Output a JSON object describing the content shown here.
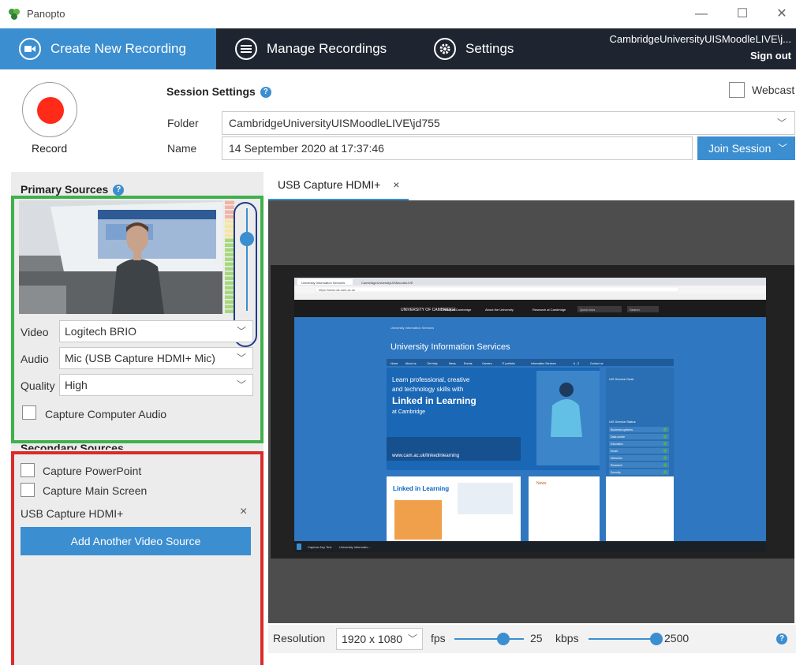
{
  "titlebar": {
    "app_title": "Panopto",
    "minimize": "—",
    "maximize": "☐",
    "close": "✕"
  },
  "nav": {
    "tabs": [
      {
        "label": "Create New Recording",
        "icon": "camera-icon",
        "active": true
      },
      {
        "label": "Manage Recordings",
        "icon": "list-icon",
        "active": false
      },
      {
        "label": "Settings",
        "icon": "gear-icon",
        "active": false
      }
    ],
    "user": "CambridgeUniversityUISMoodleLIVE\\j...",
    "sign_out": "Sign out"
  },
  "record": {
    "label": "Record"
  },
  "session": {
    "title": "Session Settings",
    "help": "?",
    "webcast_label": "Webcast",
    "webcast_checked": false,
    "folder_label": "Folder",
    "folder_value": "CambridgeUniversityUISMoodleLIVE\\jd755",
    "name_label": "Name",
    "name_value": "14 September 2020 at 17:37:46",
    "join_label": "Join Session"
  },
  "primary": {
    "title": "Primary Sources",
    "video_label": "Video",
    "video_value": "Logitech BRIO",
    "audio_label": "Audio",
    "audio_value": "Mic (USB Capture HDMI+ Mic)",
    "quality_label": "Quality",
    "quality_value": "High",
    "capture_audio_label": "Capture Computer Audio",
    "capture_audio_checked": false,
    "audio_level": 0.75
  },
  "secondary": {
    "title": "Secondary Sources",
    "capture_ppt_label": "Capture PowerPoint",
    "capture_screen_label": "Capture Main Screen",
    "source_name": "USB Capture HDMI+",
    "remove": "×",
    "add_button": "Add Another Video Source"
  },
  "preview": {
    "tab_label": "USB Capture HDMI+",
    "tab_close": "×",
    "screen": {
      "browser_tab1": "University Information Services",
      "browser_tab2": "CambridgeUniversityUISMoodleLIVE",
      "url": "https://www.uis.cam.ac.uk",
      "univ_logo": "UNIVERSITY OF CAMBRIDGE",
      "nav1": "Study at Cambridge",
      "nav2": "About the University",
      "nav3": "Research at Cambridge",
      "quick_links": "Quick links",
      "search": "Search",
      "breadcrumb": "University Information Services",
      "site_title": "University Information Services",
      "subnav": [
        "Home",
        "About us",
        "Get help",
        "News",
        "Events",
        "Careers",
        "IT portfolio",
        "Information Services",
        "A - Z",
        "Contact us"
      ],
      "hero_line1": "Learn professional, creative",
      "hero_line2": "and technology skills with",
      "hero_brand": "Linked in Learning",
      "hero_sub": "at Cambridge",
      "hero_url": "www.cam.ac.uk/linkedinlearning",
      "service_desk": "UIS Service Desk",
      "service_status": "UIS Service Status",
      "status_items": [
        "Business systems",
        "Data centre",
        "Education",
        "Email",
        "Networks",
        "Research",
        "Security"
      ],
      "news_title": "News",
      "taskbar_item1": "Capture Any Text",
      "taskbar_item2": "University Informatio..."
    }
  },
  "bottom": {
    "resolution_label": "Resolution",
    "resolution_value": "1920 x 1080",
    "fps_label": "fps",
    "fps_value": "25",
    "fps_level": 0.7,
    "kbps_label": "kbps",
    "kbps_value": "2500",
    "kbps_level": 1.0,
    "help": "?"
  },
  "colors": {
    "accent": "#3b8ed0",
    "nav_bg": "#1f2530",
    "record_red": "#ff2a17",
    "highlight_green": "#3fb04b",
    "highlight_red": "#d92b2b",
    "panel_bg": "#ececec"
  }
}
